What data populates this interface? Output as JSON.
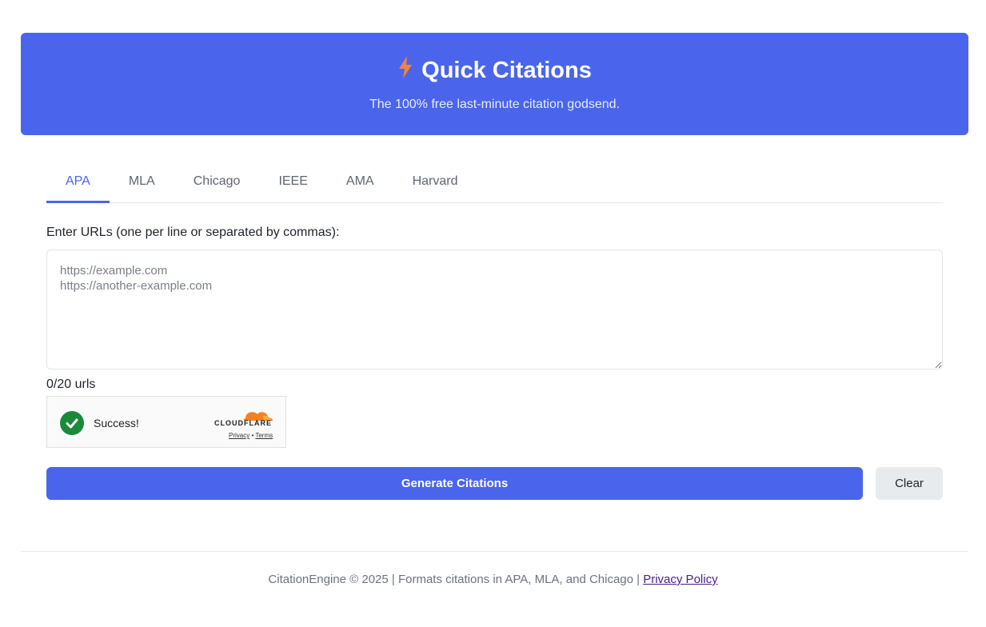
{
  "header": {
    "icon": "lightning-bolt-icon",
    "title": "Quick Citations",
    "subtitle": "The 100% free last-minute citation godsend.",
    "accent_color": "#4a65ec",
    "icon_color": "#f4823a"
  },
  "tabs": [
    {
      "label": "APA",
      "active": true
    },
    {
      "label": "MLA",
      "active": false
    },
    {
      "label": "Chicago",
      "active": false
    },
    {
      "label": "IEEE",
      "active": false
    },
    {
      "label": "AMA",
      "active": false
    },
    {
      "label": "Harvard",
      "active": false
    }
  ],
  "form": {
    "label": "Enter URLs (one per line or separated by commas):",
    "value": "",
    "placeholder": "https://example.com\nhttps://another-example.com",
    "counter": "0/20 urls"
  },
  "captcha": {
    "status_icon": "check-circle-icon",
    "status_text": "Success!",
    "brand": "CLOUDFLARE",
    "privacy_label": "Privacy",
    "separator": "•",
    "terms_label": "Terms"
  },
  "actions": {
    "generate_label": "Generate Citations",
    "clear_label": "Clear"
  },
  "footer": {
    "text": "CitationEngine © 2025 | Formats citations in APA, MLA, and Chicago | ",
    "privacy_link": "Privacy Policy"
  }
}
